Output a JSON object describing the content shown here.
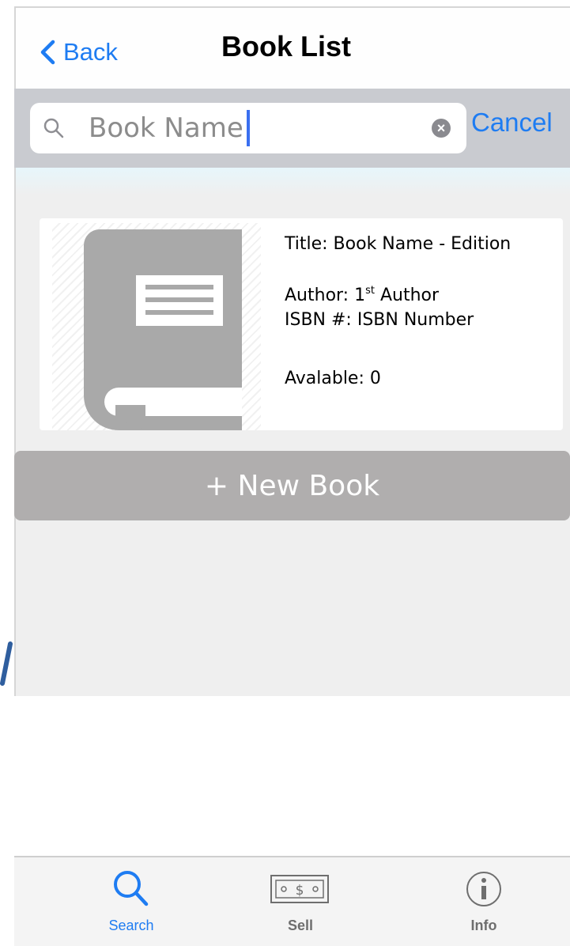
{
  "header": {
    "back_label": "Back",
    "title": "Book List"
  },
  "search": {
    "value": "Book Name",
    "cancel_label": "Cancel",
    "clear_glyph": "×"
  },
  "book": {
    "title_line": "Title: Book Name - Edition",
    "author_prefix": "Author: 1",
    "author_sup": "st",
    "author_suffix": " Author",
    "isbn_line": "ISBN #:  ISBN Number",
    "available_line": "Avalable: 0"
  },
  "new_book_label": "+ New Book",
  "tabs": [
    {
      "label": "Search",
      "icon": "search-icon",
      "active": true
    },
    {
      "label": "Sell",
      "icon": "money-icon",
      "active": false
    },
    {
      "label": "Info",
      "icon": "info-icon",
      "active": false
    }
  ],
  "colors": {
    "accent": "#1e7cf2",
    "search_bar_bg": "#c9cbd0",
    "button_gray": "#b0aeae",
    "book_gray": "#a9a9a9"
  }
}
